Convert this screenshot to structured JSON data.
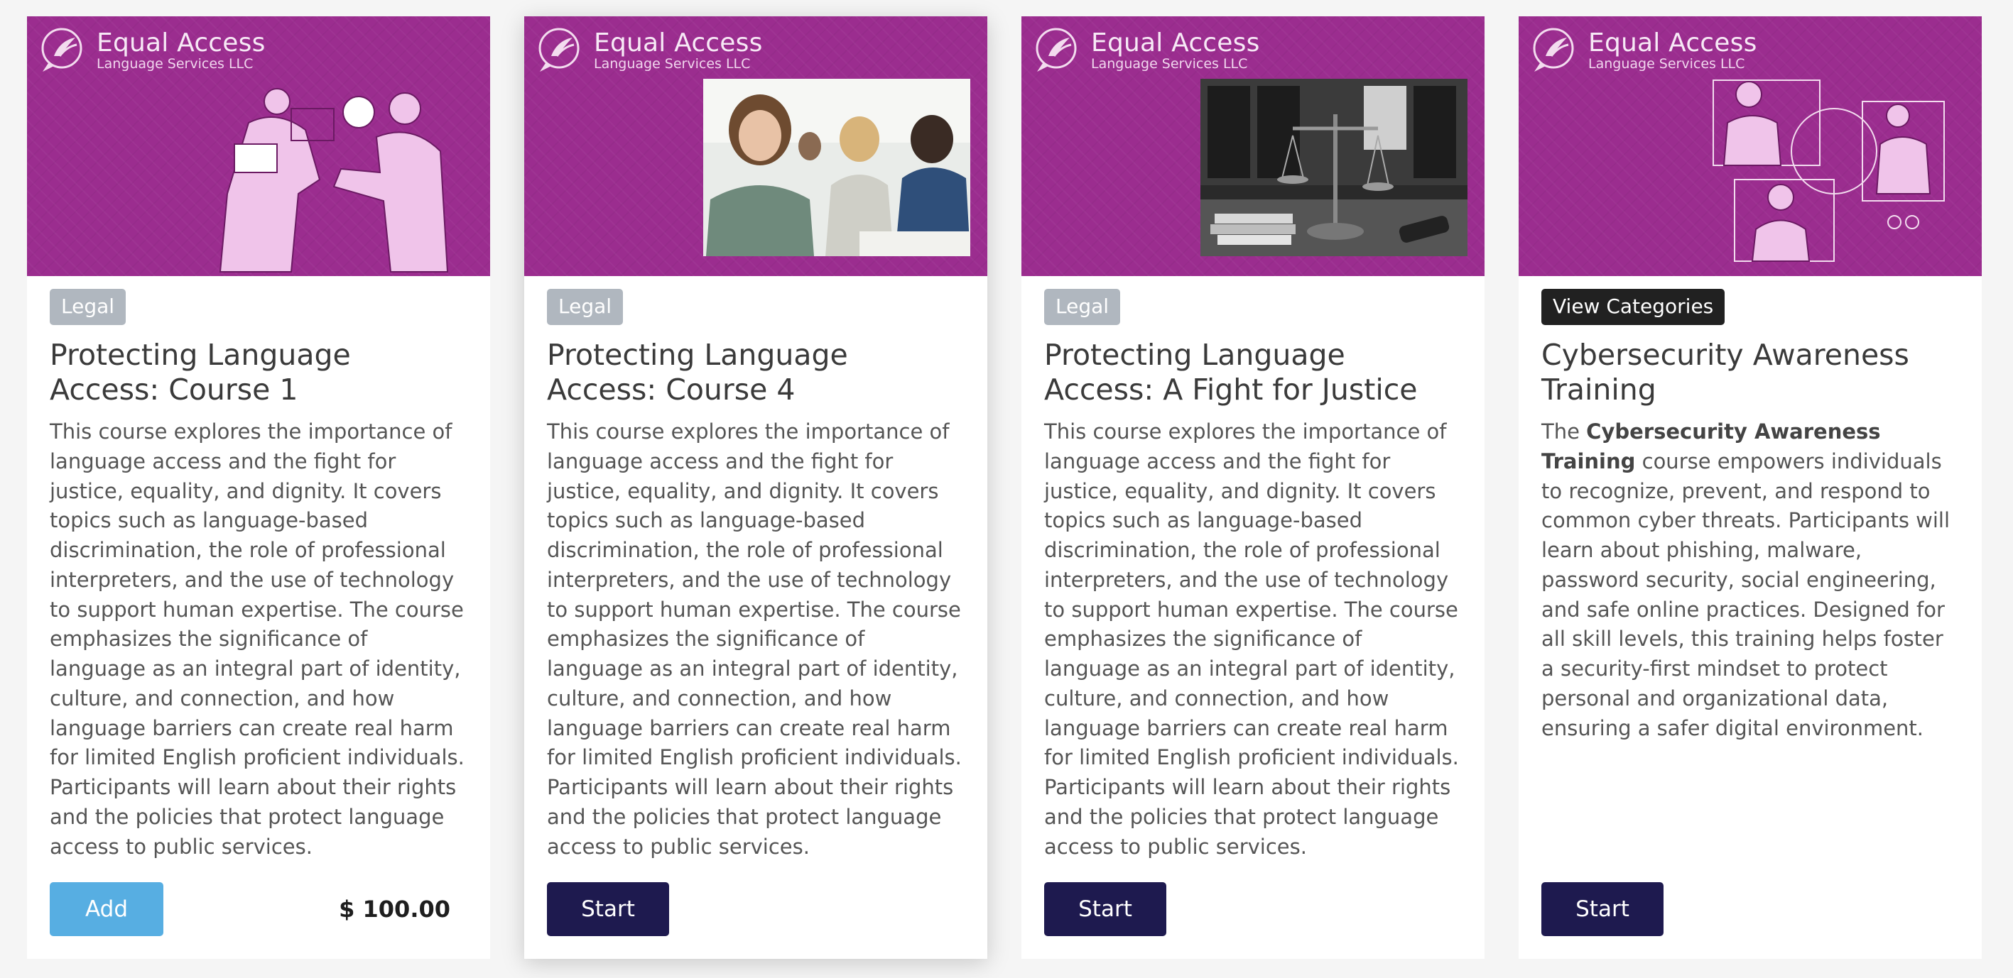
{
  "brand": {
    "name": "Equal Access",
    "sub": "Language Services LLC"
  },
  "colors": {
    "banner": "#9b2d8f",
    "badge_legal": "#b0b7bf",
    "badge_dark": "#212121",
    "add_button": "#57aee2",
    "start_button": "#1e1a4f"
  },
  "cards": [
    {
      "badge": "Legal",
      "title": "Protecting Language Access: Course 1",
      "description": "This course explores the importance of language access and the fight for justice, equality, and dignity. It covers topics such as language-based discrimination, the role of professional interpreters, and the use of technology to support human expertise. The course emphasizes the significance of language as an integral part of identity, culture, and connection, and how language barriers can create real harm for limited English proficient individuals. Participants will learn about their rights and the policies that protect language access to public services.",
      "button": "Add",
      "price": "$ 100.00",
      "image": "handshake-illustration"
    },
    {
      "badge": "Legal",
      "title": "Protecting Language Access: Course 4",
      "description": "This course explores the importance of language access and the fight for justice, equality, and dignity. It covers topics such as language-based discrimination, the role of professional interpreters, and the use of technology to support human expertise. The course emphasizes the significance of language as an integral part of identity, culture, and connection, and how language barriers can create real harm for limited English proficient individuals. Participants will learn about their rights and the policies that protect language access to public services.",
      "button": "Start",
      "image": "classroom-photo"
    },
    {
      "badge": "Legal",
      "title": "Protecting Language Access: A Fight for Justice",
      "description": "This course explores the importance of language access and the fight for justice, equality, and dignity. It covers topics such as language-based discrimination, the role of professional interpreters, and the use of technology to support human expertise. The course emphasizes the significance of language as an integral part of identity, culture, and connection, and how language barriers can create real harm for limited English proficient individuals. Participants will learn about their rights and the policies that protect language access to public services.",
      "button": "Start",
      "image": "justice-scales-photo"
    },
    {
      "badge": "View Categories",
      "title": "Cybersecurity Awareness Training",
      "desc_pre": "The ",
      "desc_bold": "Cybersecurity Awareness Training",
      "desc_post": " course empowers individuals to recognize, prevent, and respond to common cyber threats. Participants will learn about phishing, malware, password security, social engineering, and safe online practices. Designed for all skill levels, this training helps foster a security-first mindset to protect personal and organizational data, ensuring a safer digital environment.",
      "button": "Start",
      "image": "video-call-illustration"
    }
  ]
}
